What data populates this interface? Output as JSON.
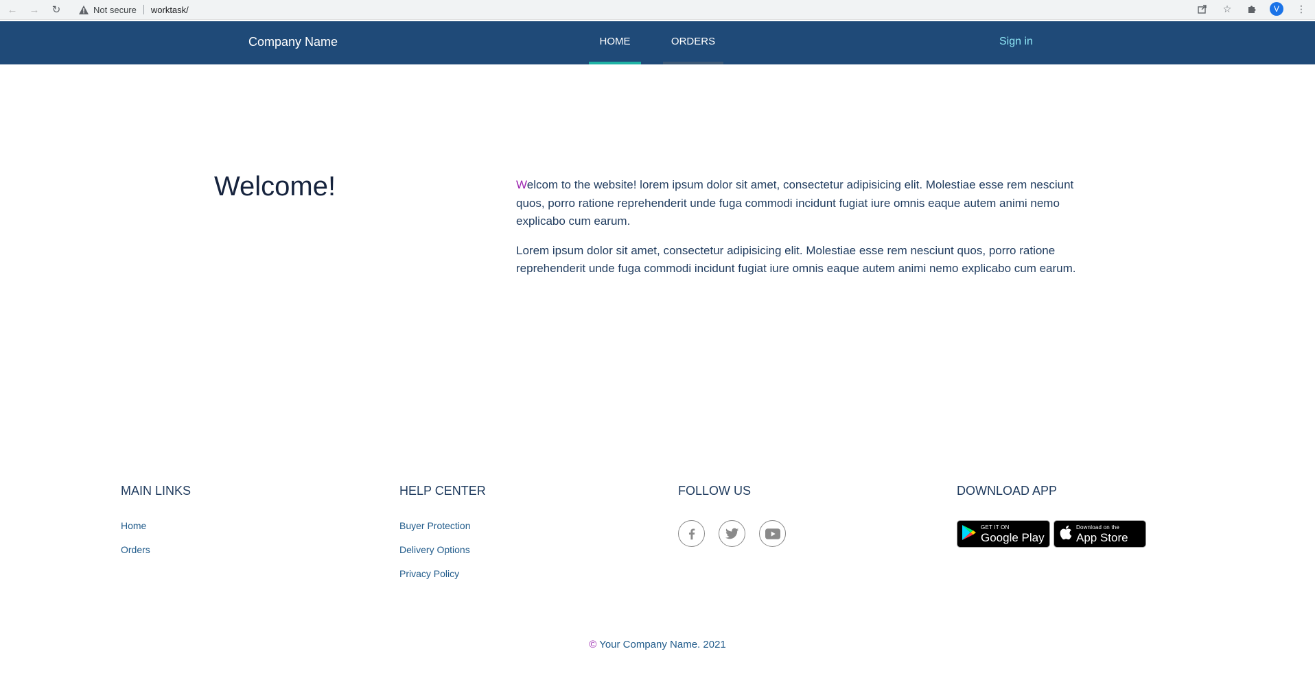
{
  "browser": {
    "security_label": "Not secure",
    "url": "worktask/",
    "profile_initial": "V"
  },
  "header": {
    "brand": "Company Name",
    "nav": [
      {
        "label": "HOME",
        "active": true
      },
      {
        "label": "ORDERS",
        "active": false
      }
    ],
    "signin": "Sign in"
  },
  "main": {
    "title": "Welcome!",
    "paragraph1_first_letter": "W",
    "paragraph1_rest": "elcom to the website! lorem ipsum dolor sit amet, consectetur adipisicing elit. Molestiae esse rem nesciunt quos, porro ratione reprehenderit unde fuga commodi incidunt fugiat iure omnis eaque autem animi nemo explicabo cum earum.",
    "paragraph2": "Lorem ipsum dolor sit amet, consectetur adipisicing elit. Molestiae esse rem nesciunt quos, porro ratione reprehenderit unde fuga commodi incidunt fugiat iure omnis eaque autem animi nemo explicabo cum earum."
  },
  "footer": {
    "main_links": {
      "heading": "MAIN LINKS",
      "links": [
        "Home",
        "Orders"
      ]
    },
    "help_center": {
      "heading": "HELP CENTER",
      "links": [
        "Buyer Protection",
        "Delivery Options",
        "Privacy Policy"
      ]
    },
    "follow_us": {
      "heading": "FOLLOW US",
      "icons": [
        "facebook-icon",
        "twitter-icon",
        "youtube-icon"
      ]
    },
    "download_app": {
      "heading": "DOWNLOAD APP",
      "google_play": {
        "small": "GET IT ON",
        "big": "Google Play"
      },
      "app_store": {
        "small": "Download on the",
        "big": "App Store"
      }
    },
    "copyright_symbol": "©",
    "copyright_text": " Your Company Name. 2021"
  },
  "colors": {
    "header_bg": "#1f4a78",
    "active_underline": "#1fb3a5",
    "accent_purple": "#9c27b0",
    "signin": "#8ee6f5"
  }
}
